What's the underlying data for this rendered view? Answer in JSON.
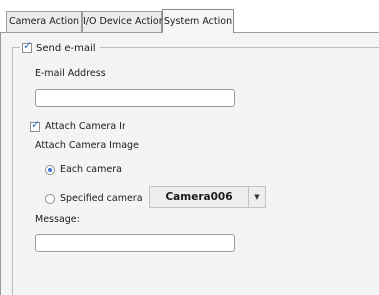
{
  "tabs": [
    {
      "label": "Camera Action",
      "active": false
    },
    {
      "label": "I/O Device Action",
      "active": false
    },
    {
      "label": "System Action",
      "active": true
    }
  ],
  "send_email": {
    "label": "Send e-mail",
    "checked": true
  },
  "email_address": {
    "label": "E-mail Address",
    "value": "",
    "placeholder": ""
  },
  "attach_camera_image_checkbox": {
    "label": "Attach Camera Image",
    "checked": true
  },
  "attach_camera_image_heading": "Attach Camera Image",
  "camera_selection": {
    "options": [
      {
        "label": "Each camera",
        "selected": true
      },
      {
        "label": "Specified camera",
        "selected": false
      }
    ],
    "camera_dropdown_value": "Camera006"
  },
  "message": {
    "label": "Message:",
    "value": "",
    "placeholder": ""
  },
  "colors": {
    "accent": "#3a78d0",
    "panel_bg": "#f4f4f4"
  }
}
